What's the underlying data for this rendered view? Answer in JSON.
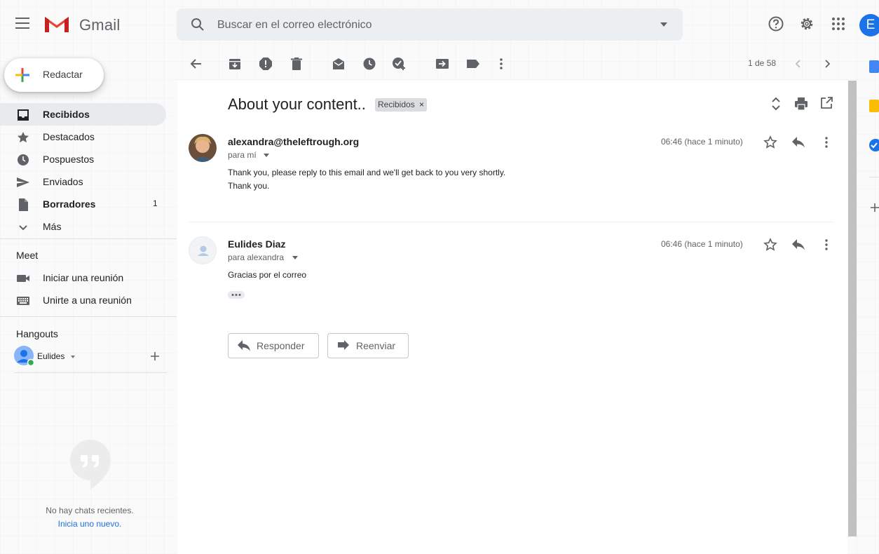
{
  "header": {
    "app_name": "Gmail",
    "search_placeholder": "Buscar en el correo electrónico",
    "account_initial": "E"
  },
  "sidebar": {
    "compose_label": "Redactar",
    "items": [
      {
        "label": "Recibidos",
        "icon": "inbox-icon",
        "bold": true,
        "active": true,
        "count": ""
      },
      {
        "label": "Destacados",
        "icon": "star-icon",
        "bold": false,
        "active": false,
        "count": ""
      },
      {
        "label": "Pospuestos",
        "icon": "clock-icon",
        "bold": false,
        "active": false,
        "count": ""
      },
      {
        "label": "Enviados",
        "icon": "send-icon",
        "bold": false,
        "active": false,
        "count": ""
      },
      {
        "label": "Borradores",
        "icon": "draft-icon",
        "bold": true,
        "active": false,
        "count": "1"
      },
      {
        "label": "Más",
        "icon": "chevron-down-icon",
        "bold": false,
        "active": false,
        "count": ""
      }
    ],
    "meet": {
      "title": "Meet",
      "start": "Iniciar una reunión",
      "join": "Unirte a una reunión"
    },
    "hangouts": {
      "title": "Hangouts",
      "user": "Eulides",
      "no_chats": "No hay chats recientes.",
      "start_new": "Inicia uno nuevo."
    }
  },
  "toolbar": {
    "pager": "1 de 58"
  },
  "thread": {
    "subject": "About your content..",
    "label": "Recibidos",
    "messages": [
      {
        "sender": "alexandra@theleftrough.org",
        "to": "para mí",
        "time": "06:46 (hace 1 minuto)",
        "body": "Thank you, please reply to this email and we'll get back to you very shortly. Thank you."
      },
      {
        "sender": "Eulides Diaz",
        "to": "para alexandra",
        "time": "06:46 (hace 1 minuto)",
        "body": "Gracias por el correo"
      }
    ],
    "reply_label": "Responder",
    "forward_label": "Reenviar"
  },
  "colors": {
    "accent": "#1a73e8",
    "active_bg": "#e8eaed",
    "online": "#34a853"
  }
}
